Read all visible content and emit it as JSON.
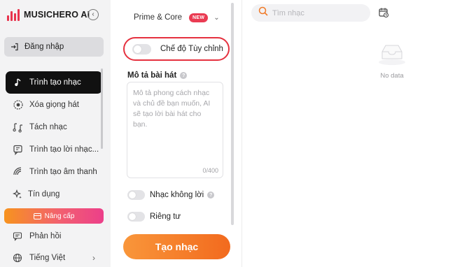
{
  "app": {
    "name": "MUSICHERO AI",
    "brand_color": "#e8344e"
  },
  "sidebar": {
    "collapse_icon": "chevron-left-icon",
    "login_label": "Đăng nhập",
    "items": [
      {
        "label": "Trình tạo nhạc",
        "icon": "music-note-icon",
        "active": true
      },
      {
        "label": "Xóa giọng hát",
        "icon": "vocal-remove-icon",
        "active": false
      },
      {
        "label": "Tách nhạc",
        "icon": "split-icon",
        "active": false
      },
      {
        "label": "Trình tạo lời nhạc...",
        "icon": "lyrics-icon",
        "active": false
      },
      {
        "label": "Trình tạo âm thanh",
        "icon": "sound-icon",
        "active": false
      }
    ],
    "credits_label": "Tín dụng",
    "upgrade_label": "Nâng cấp",
    "feedback_label": "Phản hồi",
    "language_label": "Tiếng Việt"
  },
  "composer": {
    "model_label": "Prime & Core",
    "model_badge": "NEW",
    "custom_mode_label": "Chế độ Tùy chỉnh",
    "custom_mode_on": false,
    "description_label": "Mô tả bài hát",
    "description_value": "",
    "description_placeholder": "Mô tả phong cách nhạc và chủ đề bạn muốn, AI sẽ tạo lời bài hát cho bạn.",
    "description_counter": "0/400",
    "instrumental_label": "Nhạc không lời",
    "instrumental_on": false,
    "private_label": "Riêng tư",
    "private_on": false,
    "create_label": "Tạo nhạc",
    "highlight_color": "#e5313f"
  },
  "library": {
    "search_placeholder": "Tìm nhạc",
    "search_value": "",
    "empty_text": "No data"
  }
}
